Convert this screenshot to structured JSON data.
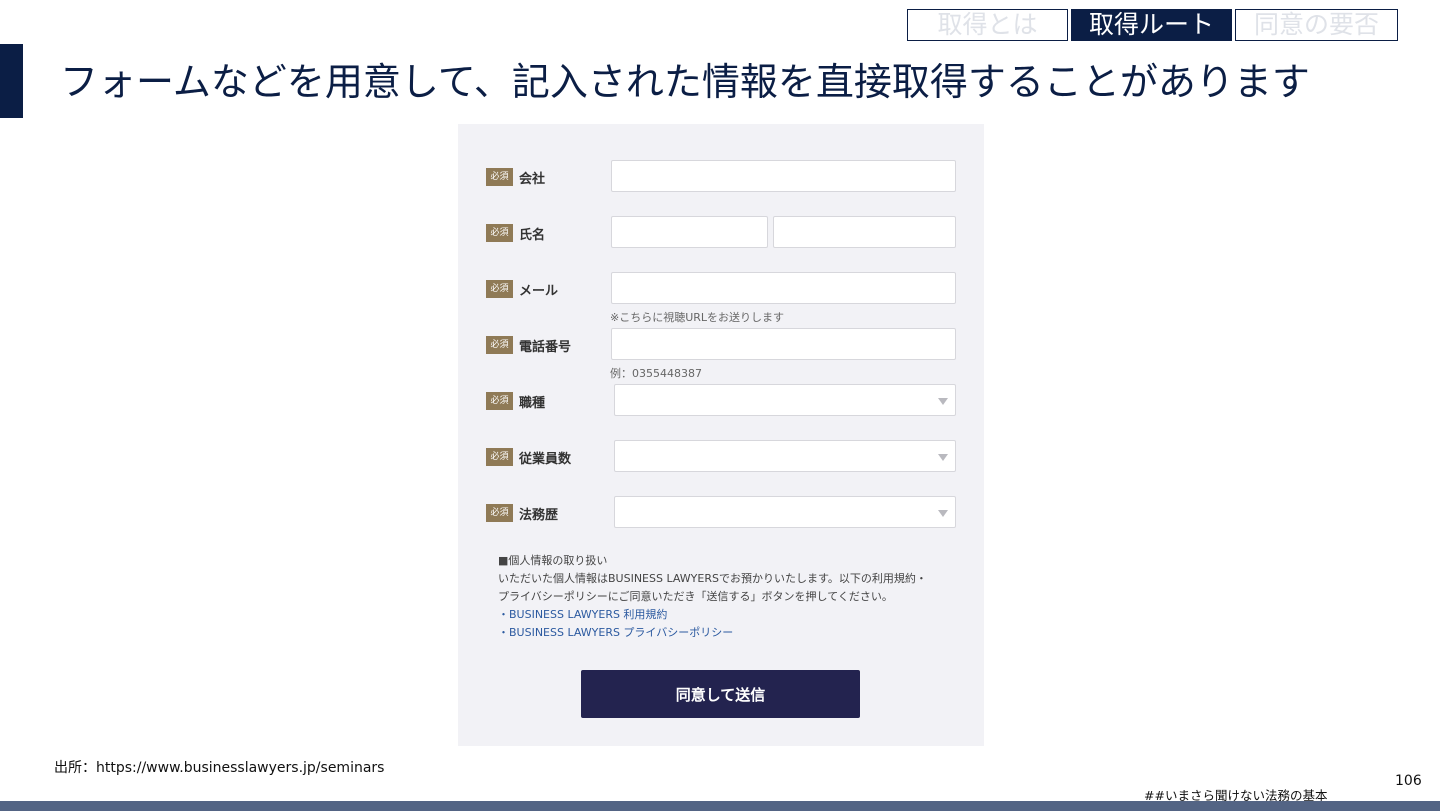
{
  "nav": {
    "tabs": [
      {
        "label": "取得とは",
        "active": false
      },
      {
        "label": "取得ルート",
        "active": true
      },
      {
        "label": "同意の要否",
        "active": false
      }
    ]
  },
  "slide": {
    "title": "フォームなどを用意して、記入された情報を直接取得することがあります",
    "source": "出所：https://www.businesslawyers.jp/seminars",
    "hashtag": "##いまさら聞けない法務の基本",
    "page_number": "106"
  },
  "colors": {
    "navy": "#0b1e45",
    "required_badge": "#8f7a56",
    "submit_button": "#23234f",
    "link": "#2c5aa0",
    "bottom_bar": "#536484"
  },
  "form": {
    "required_badge": "必須",
    "fields": {
      "company": {
        "label": "会社",
        "value": ""
      },
      "name": {
        "label": "氏名",
        "last_value": "",
        "first_value": ""
      },
      "email": {
        "label": "メール",
        "value": "",
        "hint": "※こちらに視聴URLをお送りします"
      },
      "phone": {
        "label": "電話番号",
        "value": "",
        "hint": "例：0355448387"
      },
      "job_type": {
        "label": "職種",
        "selected": ""
      },
      "employees": {
        "label": "従業員数",
        "selected": ""
      },
      "legal_experience": {
        "label": "法務歴",
        "selected": ""
      }
    },
    "privacy": {
      "heading": "■個人情報の取り扱い",
      "line1": "いただいた個人情報はBUSINESS LAWYERSでお預かりいたします。以下の利用規約・",
      "line2": "プライバシーポリシーにご同意いただき「送信する」ボタンを押してください。",
      "terms_link": "・BUSINESS LAWYERS 利用規約",
      "privacy_link": "・BUSINESS LAWYERS プライバシーポリシー"
    },
    "submit_label": "同意して送信"
  }
}
